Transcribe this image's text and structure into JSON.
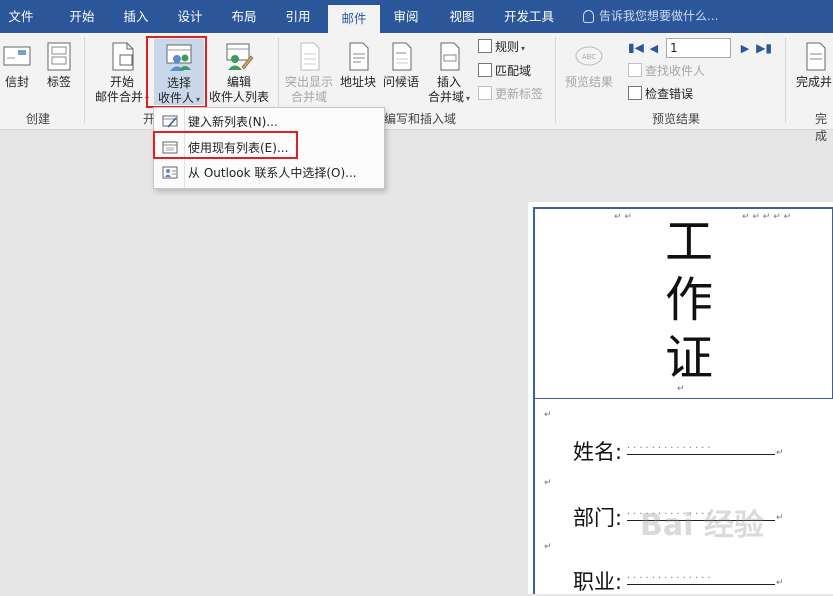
{
  "menu": {
    "tabs": [
      "文件",
      "开始",
      "插入",
      "设计",
      "布局",
      "引用",
      "邮件",
      "审阅",
      "视图",
      "开发工具"
    ],
    "active_tab": "邮件",
    "tell_me": "告诉我您想要做什么..."
  },
  "ribbon": {
    "create_group": {
      "label": "创建",
      "envelope": "信封",
      "labels": "标签"
    },
    "start_group": {
      "label": "开",
      "start_merge_line1": "开始",
      "start_merge_line2": "邮件合并",
      "select_recipients_line1": "选择",
      "select_recipients_line2": "收件人",
      "edit_recipients_line1": "编辑",
      "edit_recipients_line2": "收件人列表"
    },
    "write_group": {
      "label": "编写和插入域",
      "highlight_line1": "突出显示",
      "highlight_line2": "合并域",
      "address_block": "地址块",
      "greeting": "问候语",
      "insert_line1": "插入",
      "insert_line2": "合并域",
      "rules": "规则",
      "match_fields": "匹配域",
      "update_labels": "更新标签"
    },
    "preview_group": {
      "label": "预览结果",
      "preview_button": "预览结果",
      "record_value": "1",
      "find_recipient": "查找收件人",
      "check_errors": "检查错误"
    },
    "finish_group": {
      "label": "完成",
      "finish_line1": "完成并"
    }
  },
  "dropdown": {
    "items": [
      "键入新列表(N)...",
      "使用现有列表(E)...",
      "从 Outlook 联系人中选择(O)..."
    ]
  },
  "document": {
    "title_chars": [
      "工",
      "作",
      "证"
    ],
    "fields": [
      "姓名:",
      "部门:",
      "职业:"
    ]
  },
  "watermark": "Bai 经验",
  "colors": {
    "menu_bg": "#2b579a",
    "highlight": "#e02020",
    "ribbon_bg": "#f3f3f3"
  }
}
